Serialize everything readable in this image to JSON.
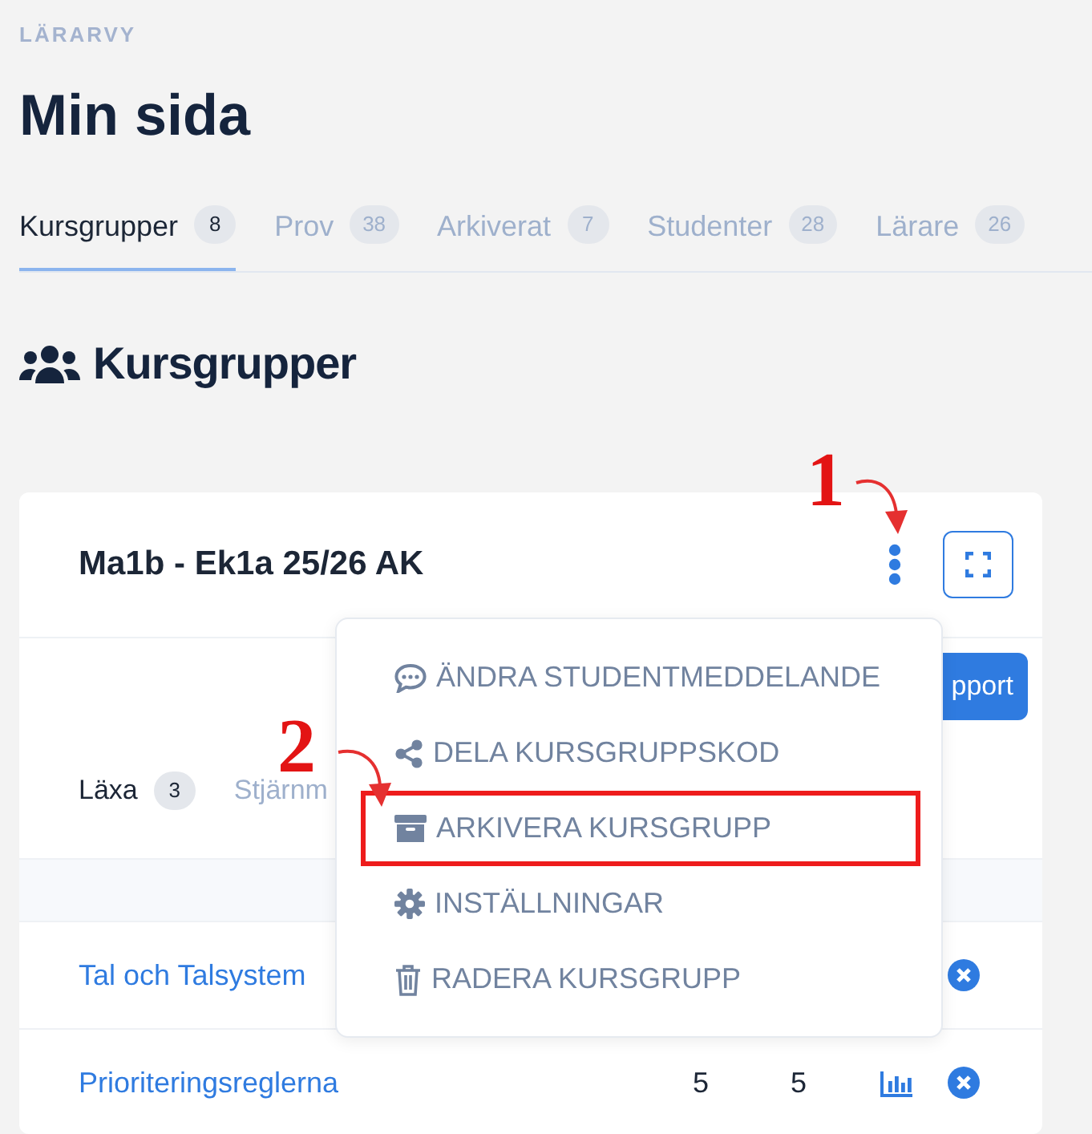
{
  "header": {
    "eyebrow": "LÄRARVY",
    "title": "Min sida"
  },
  "tabs": [
    {
      "label": "Kursgrupper",
      "count": "8",
      "selected": true
    },
    {
      "label": "Prov",
      "count": "38",
      "selected": false
    },
    {
      "label": "Arkiverat",
      "count": "7",
      "selected": false
    },
    {
      "label": "Studenter",
      "count": "28",
      "selected": false
    },
    {
      "label": "Lärare",
      "count": "26",
      "selected": false
    }
  ],
  "section": {
    "title": "Kursgrupper"
  },
  "card": {
    "title": "Ma1b - Ek1a 25/26 AK",
    "report_button": "pport",
    "subtabs": [
      {
        "label": "Läxa",
        "count": "3",
        "selected": true
      },
      {
        "label": "Stjärnm",
        "selected": false
      }
    ],
    "rows": [
      {
        "name": "Tal och Talsystem"
      },
      {
        "name": "Prioriteringsreglerna",
        "column_2": "5",
        "column_3": "5"
      }
    ],
    "menu": [
      {
        "kind": "comment",
        "label": "ÄNDRA STUDENTMEDDELANDE",
        "highlighted": false
      },
      {
        "kind": "share",
        "label": "DELA KURSGRUPPSKOD",
        "highlighted": false
      },
      {
        "kind": "archive",
        "label": "ARKIVERA KURSGRUPP",
        "highlighted": true
      },
      {
        "kind": "gear",
        "label": "INSTÄLLNINGAR",
        "highlighted": false
      },
      {
        "kind": "trash",
        "label": "RADERA KURSGRUPP",
        "highlighted": false
      }
    ]
  },
  "annotations": [
    {
      "label": "1"
    },
    {
      "label": "2"
    }
  ]
}
